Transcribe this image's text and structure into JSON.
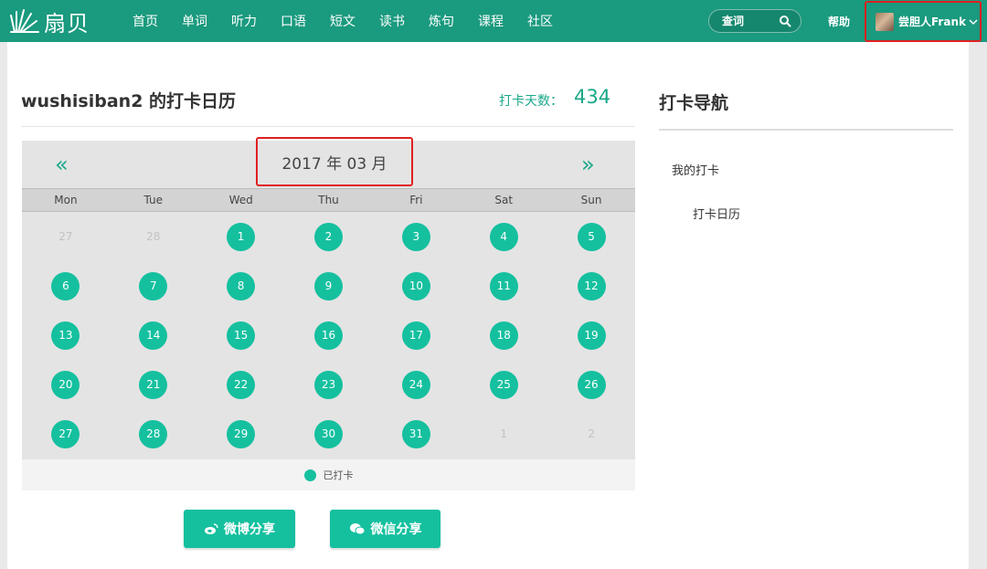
{
  "brand": {
    "name": "扇贝",
    "color": "#1a9a7e",
    "accent": "#15c09f"
  },
  "nav": {
    "items": [
      "首页",
      "单词",
      "听力",
      "口语",
      "短文",
      "读书",
      "炼句",
      "课程",
      "社区"
    ]
  },
  "search": {
    "placeholder": "查词"
  },
  "help": {
    "label": "帮助"
  },
  "user": {
    "name": "尝胆人Frank"
  },
  "calendar": {
    "title": "wushisiban2 的打卡日历",
    "checkin_label": "打卡天数：",
    "checkin_days": "434",
    "prev": "«",
    "next": "»",
    "month": "2017 年 03 月",
    "weekdays": [
      "Mon",
      "Tue",
      "Wed",
      "Thu",
      "Fri",
      "Sat",
      "Sun"
    ],
    "days": [
      {
        "n": "27",
        "checked": false
      },
      {
        "n": "28",
        "checked": false
      },
      {
        "n": "1",
        "checked": true
      },
      {
        "n": "2",
        "checked": true
      },
      {
        "n": "3",
        "checked": true
      },
      {
        "n": "4",
        "checked": true
      },
      {
        "n": "5",
        "checked": true
      },
      {
        "n": "6",
        "checked": true
      },
      {
        "n": "7",
        "checked": true
      },
      {
        "n": "8",
        "checked": true
      },
      {
        "n": "9",
        "checked": true
      },
      {
        "n": "10",
        "checked": true
      },
      {
        "n": "11",
        "checked": true
      },
      {
        "n": "12",
        "checked": true
      },
      {
        "n": "13",
        "checked": true
      },
      {
        "n": "14",
        "checked": true
      },
      {
        "n": "15",
        "checked": true
      },
      {
        "n": "16",
        "checked": true
      },
      {
        "n": "17",
        "checked": true
      },
      {
        "n": "18",
        "checked": true
      },
      {
        "n": "19",
        "checked": true
      },
      {
        "n": "20",
        "checked": true
      },
      {
        "n": "21",
        "checked": true
      },
      {
        "n": "22",
        "checked": true
      },
      {
        "n": "23",
        "checked": true
      },
      {
        "n": "24",
        "checked": true
      },
      {
        "n": "25",
        "checked": true
      },
      {
        "n": "26",
        "checked": true
      },
      {
        "n": "27",
        "checked": true
      },
      {
        "n": "28",
        "checked": true
      },
      {
        "n": "29",
        "checked": true
      },
      {
        "n": "30",
        "checked": true
      },
      {
        "n": "31",
        "checked": true
      },
      {
        "n": "1",
        "checked": false
      },
      {
        "n": "2",
        "checked": false
      }
    ],
    "legend": "已打卡"
  },
  "share": {
    "weibo": "微博分享",
    "wechat": "微信分享"
  },
  "sidebar": {
    "title": "打卡导航",
    "items": [
      "我的打卡",
      "打卡日历"
    ]
  }
}
